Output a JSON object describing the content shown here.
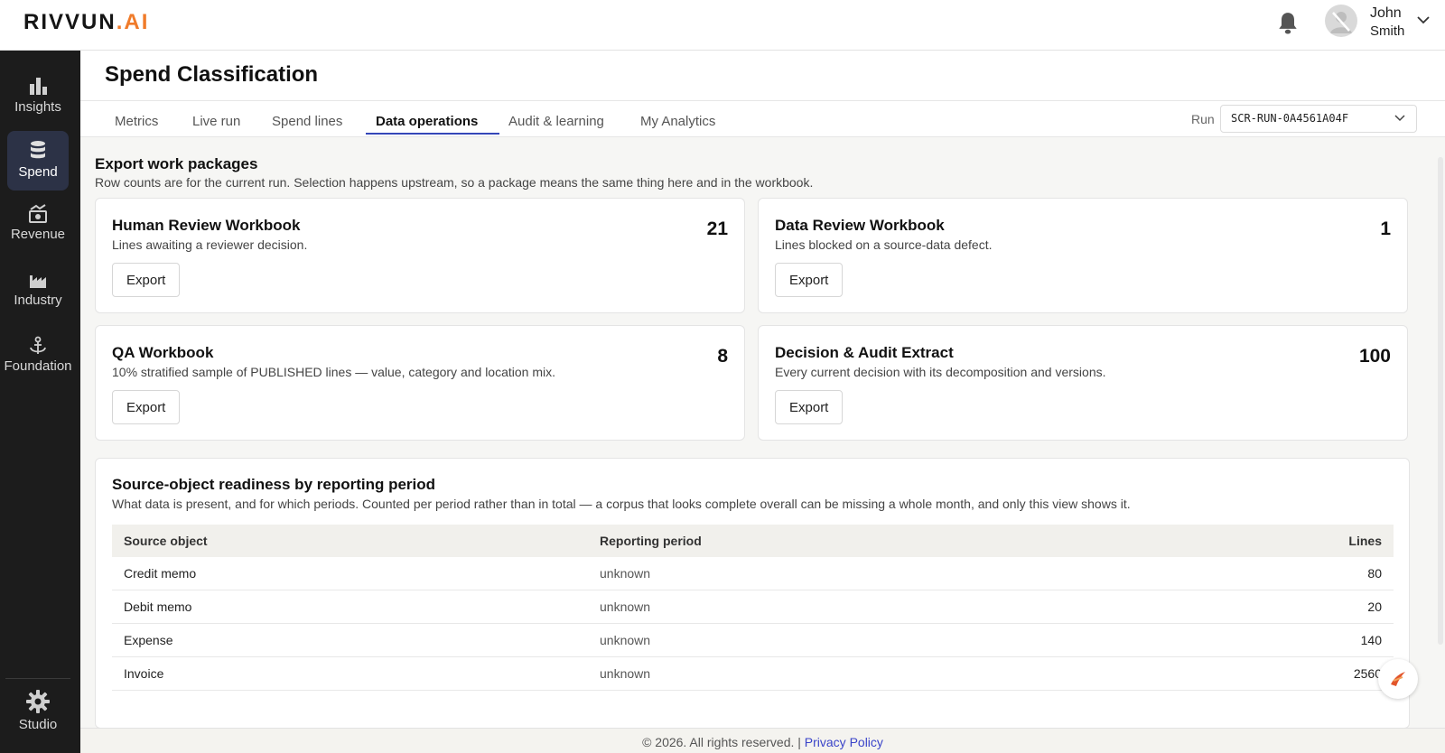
{
  "app": {
    "logo_main": "RIVVUN",
    "logo_accent": ".AI"
  },
  "header": {
    "user_name": "John",
    "user_surname": "Smith",
    "icons": [
      "bell-icon",
      "avatar-icon",
      "chevron-down-icon"
    ]
  },
  "sidebar": {
    "items": [
      {
        "label": "Insights",
        "icon": "bar-chart-icon"
      },
      {
        "label": "Spend",
        "icon": "database-icon"
      },
      {
        "label": "Revenue",
        "icon": "revenue-icon"
      },
      {
        "label": "Industry",
        "icon": "factory-icon"
      },
      {
        "label": "Foundation",
        "icon": "anchor-icon"
      }
    ],
    "studio": {
      "label": "Studio",
      "icon": "gear-icon"
    }
  },
  "page": {
    "title": "Spend Classification",
    "tabs": [
      {
        "label": "Metrics"
      },
      {
        "label": "Live run"
      },
      {
        "label": "Spend lines"
      },
      {
        "label": "Data operations",
        "active": true
      },
      {
        "label": "Audit & learning"
      },
      {
        "label": "My Analytics"
      }
    ],
    "run_label": "Run",
    "run_value": "SCR-RUN-0A4561A04F"
  },
  "export": {
    "title": "Export work packages",
    "subtitle": "Row counts are for the current run. Selection happens upstream, so a package means the same thing here and in the workbook.",
    "button_label": "Export",
    "cards": [
      {
        "title": "Human Review Workbook",
        "desc": "Lines awaiting a reviewer decision.",
        "count": "21"
      },
      {
        "title": "Data Review Workbook",
        "desc": "Lines blocked on a source-data defect.",
        "count": "1"
      },
      {
        "title": "QA Workbook",
        "desc": "10% stratified sample of PUBLISHED lines — value, category and location mix.",
        "count": "8"
      },
      {
        "title": "Decision & Audit Extract",
        "desc": "Every current decision with its decomposition and versions.",
        "count": "100"
      }
    ]
  },
  "readiness": {
    "title": "Source-object readiness by reporting period",
    "subtitle": "What data is present, and for which periods. Counted per period rather than in total — a corpus that looks complete overall can be missing a whole month, and only this view shows it.",
    "columns": [
      "Source object",
      "Reporting period",
      "Lines"
    ],
    "rows": [
      {
        "source": "Credit memo",
        "period": "unknown",
        "lines": "80"
      },
      {
        "source": "Debit memo",
        "period": "unknown",
        "lines": "20"
      },
      {
        "source": "Expense",
        "period": "unknown",
        "lines": "140"
      },
      {
        "source": "Invoice",
        "period": "unknown",
        "lines": "2560"
      }
    ]
  },
  "footer": {
    "copyright": "© 2026. All rights reserved. | ",
    "privacy": "Privacy Policy"
  }
}
